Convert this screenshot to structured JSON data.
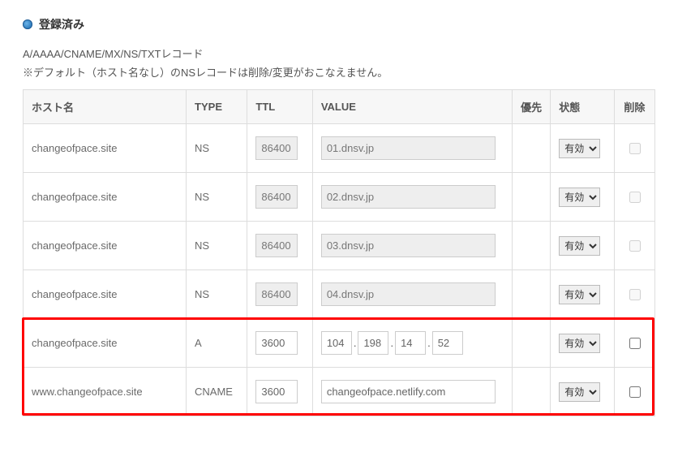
{
  "section": {
    "title": "登録済み",
    "subtitle": "A/AAAA/CNAME/MX/NS/TXTレコード",
    "note": "※デフォルト（ホスト名なし）のNSレコードは削除/変更がおこなえません。"
  },
  "headers": {
    "host": "ホスト名",
    "type": "TYPE",
    "ttl": "TTL",
    "value": "VALUE",
    "priority": "優先",
    "state": "状態",
    "delete": "削除"
  },
  "state_option": "有効",
  "rows": [
    {
      "host": "changeofpace.site",
      "type": "NS",
      "ttl": "86400",
      "value_kind": "text",
      "value": "01.dnsv.jp",
      "readonly": true
    },
    {
      "host": "changeofpace.site",
      "type": "NS",
      "ttl": "86400",
      "value_kind": "text",
      "value": "02.dnsv.jp",
      "readonly": true
    },
    {
      "host": "changeofpace.site",
      "type": "NS",
      "ttl": "86400",
      "value_kind": "text",
      "value": "03.dnsv.jp",
      "readonly": true
    },
    {
      "host": "changeofpace.site",
      "type": "NS",
      "ttl": "86400",
      "value_kind": "text",
      "value": "04.dnsv.jp",
      "readonly": true
    },
    {
      "host": "changeofpace.site",
      "type": "A",
      "ttl": "3600",
      "value_kind": "ip",
      "ip": [
        "104",
        "198",
        "14",
        "52"
      ],
      "readonly": false
    },
    {
      "host": "www.changeofpace.site",
      "type": "CNAME",
      "ttl": "3600",
      "value_kind": "text",
      "value": "changeofpace.netlify.com",
      "readonly": false
    }
  ]
}
